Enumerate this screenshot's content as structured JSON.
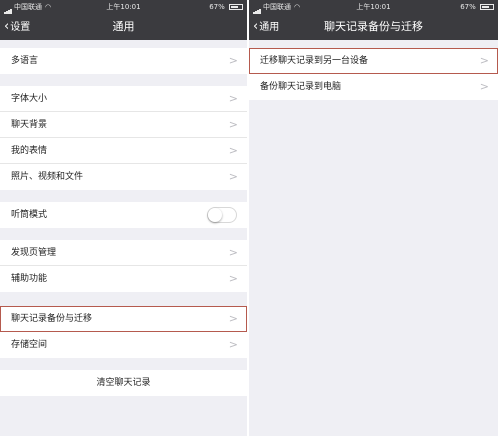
{
  "left": {
    "status": {
      "carrier": "中国联通",
      "time": "上午10:01",
      "battery": "67%",
      "battery_level": 0.67
    },
    "nav": {
      "back_label": "设置",
      "title": "通用"
    },
    "groups": [
      [
        "多语言"
      ],
      [
        "字体大小",
        "聊天背景",
        "我的表情",
        "照片、视频和文件"
      ],
      [
        "听筒模式"
      ],
      [
        "发现页管理",
        "辅助功能"
      ],
      [
        "聊天记录备份与迁移",
        "存储空间"
      ],
      [
        "清空聊天记录"
      ]
    ],
    "toggle_on": false
  },
  "right": {
    "status": {
      "carrier": "中国联通",
      "time": "上午10:01",
      "battery": "67%",
      "battery_level": 0.67
    },
    "nav": {
      "back_label": "通用",
      "title": "聊天记录备份与迁移"
    },
    "items": [
      "迁移聊天记录到另一台设备",
      "备份聊天记录到电脑"
    ]
  },
  "icons": {
    "arrow": ">",
    "back": "‹"
  },
  "colors": {
    "navbar": "#3b3b3f",
    "background": "#efeff4",
    "highlight": "#b55a4e"
  }
}
